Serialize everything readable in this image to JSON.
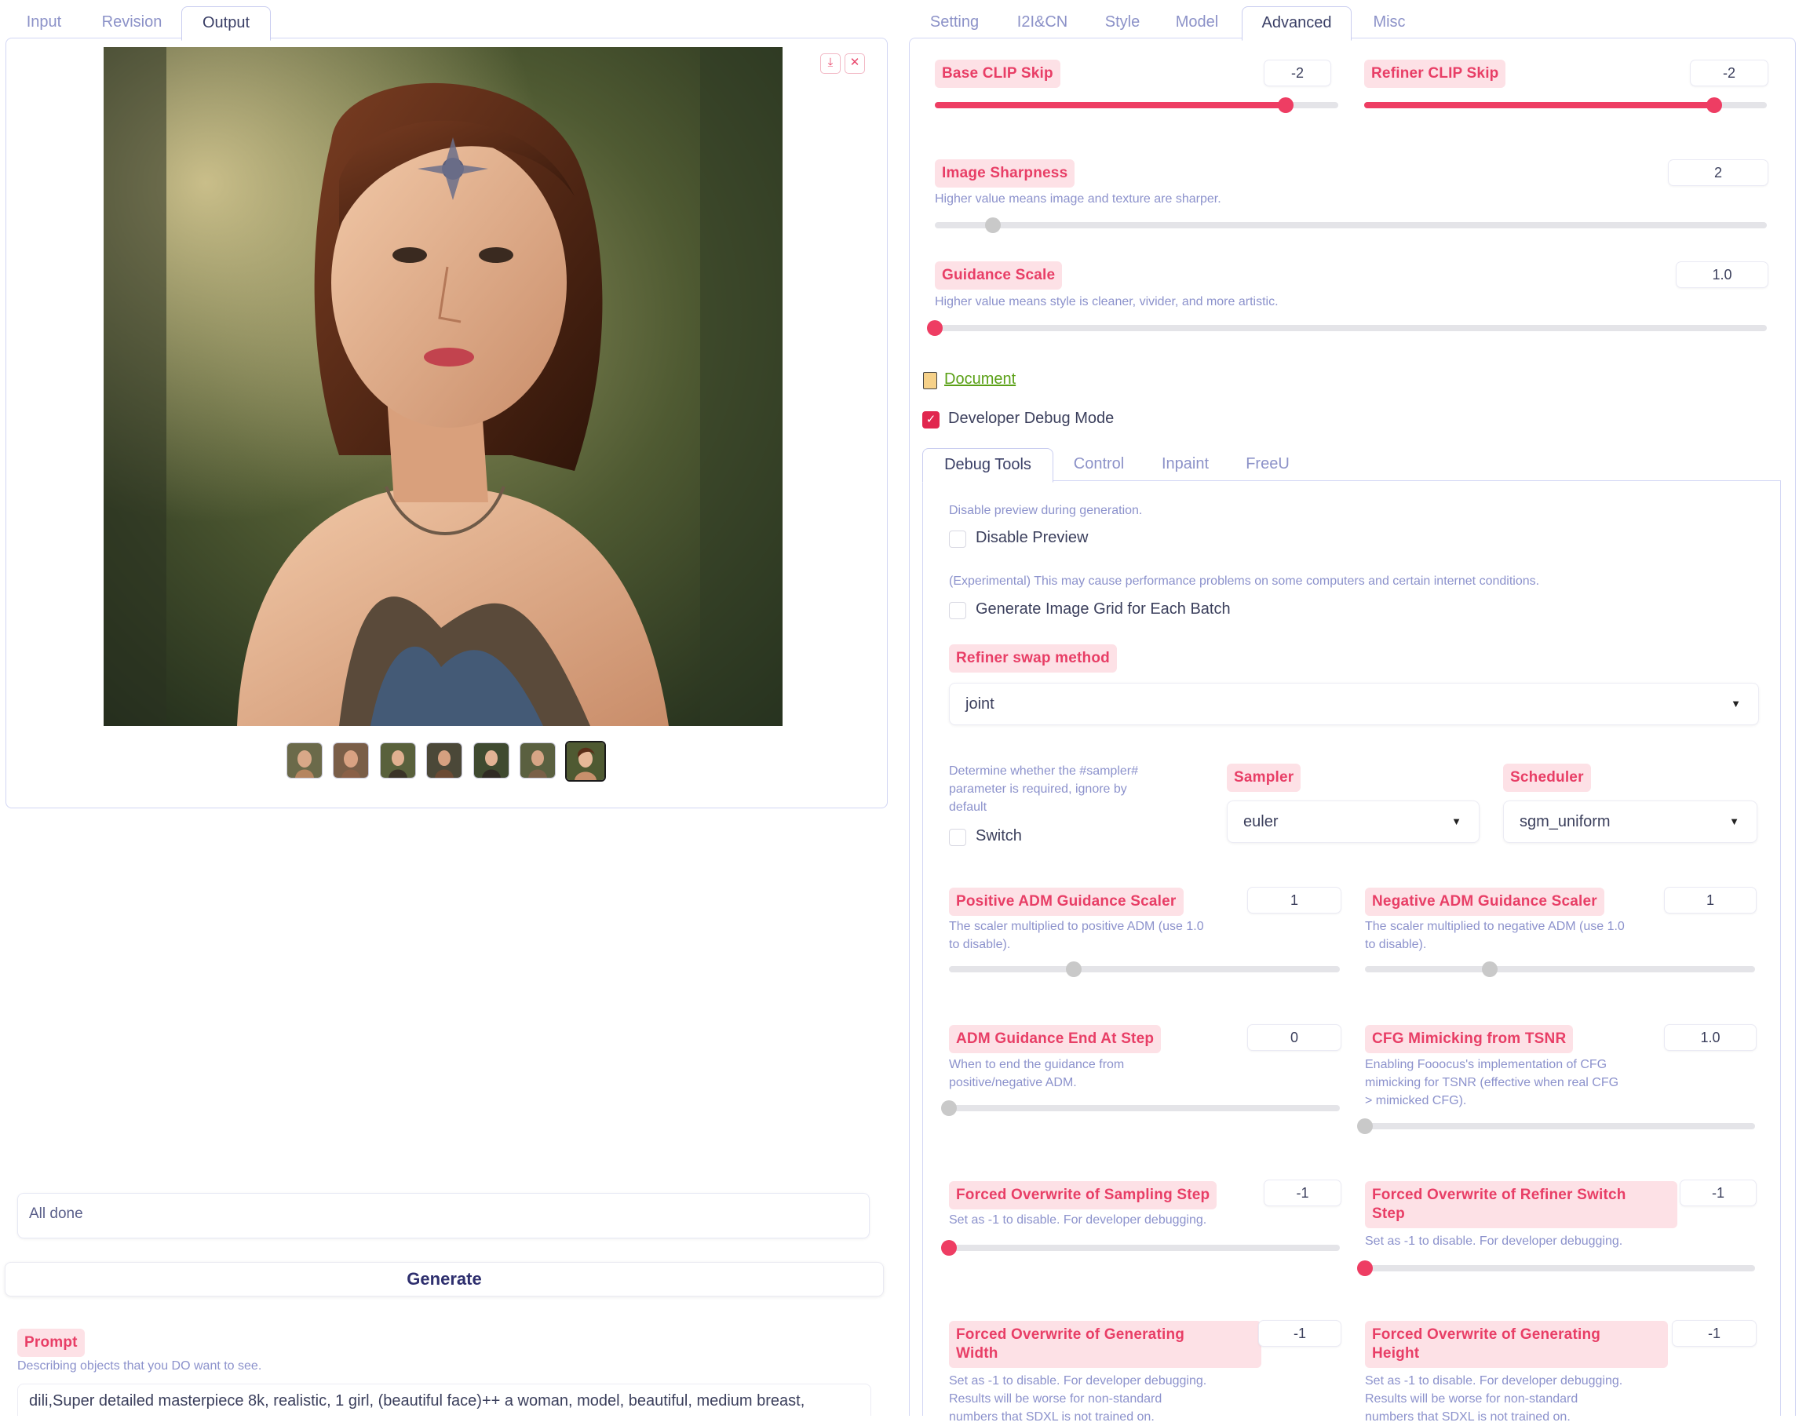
{
  "left_tabs": [
    "Input",
    "Revision",
    "Output"
  ],
  "right_tabs": [
    "Setting",
    "I2I&CN",
    "Style",
    "Model",
    "Advanced",
    "Misc"
  ],
  "image_controls": {
    "download_icon": "⤓",
    "close_icon": "✕"
  },
  "status_text": "All done",
  "generate_label": "Generate",
  "prompt": {
    "label": "Prompt",
    "info": "Describing objects that you DO want to see.",
    "value": "dili,Super detailed masterpiece 8k, realistic, 1 girl, (beautiful face)++ a woman, model, beautiful, medium breast,"
  },
  "advanced": {
    "base_clip_skip": {
      "label": "Base CLIP Skip",
      "value": "-2",
      "level": 0.87
    },
    "refiner_clip_skip": {
      "label": "Refiner CLIP Skip",
      "value": "-2",
      "level": 0.87
    },
    "image_sharpness": {
      "label": "Image Sharpness",
      "info": "Higher value means image and texture are sharper.",
      "value": "2",
      "level": 0.07
    },
    "guidance_scale": {
      "label": "Guidance Scale",
      "info": "Higher value means style is cleaner, vivider, and more artistic.",
      "value": "1.0",
      "level": 0.0
    },
    "document_link": "Document",
    "debug_mode_label": "Developer Debug Mode"
  },
  "debug_tabs": [
    "Debug Tools",
    "Control",
    "Inpaint",
    "FreeU"
  ],
  "debug": {
    "disable_preview_info": "Disable preview during generation.",
    "disable_preview_label": "Disable Preview",
    "grid_info": "(Experimental) This may cause performance problems on some computers and certain internet conditions.",
    "grid_label": "Generate Image Grid for Each Batch",
    "refiner_swap_label": "Refiner swap method",
    "refiner_swap_value": "joint",
    "sampler_switch_info_1": "Determine whether the #sampler#",
    "sampler_switch_info_2": "parameter is required, ignore by",
    "sampler_switch_info_3": "default",
    "switch_label": "Switch",
    "sampler_label": "Sampler",
    "sampler_value": "euler",
    "scheduler_label": "Scheduler",
    "scheduler_value": "sgm_uniform",
    "pos_adm": {
      "label": "Positive ADM Guidance Scaler",
      "value": "1",
      "info_1": "The scaler multiplied to positive ADM (use 1.0",
      "info_2": "to disable).",
      "level": 0.32
    },
    "neg_adm": {
      "label": "Negative ADM Guidance Scaler",
      "value": "1",
      "info_1": "The scaler multiplied to negative ADM (use 1.0",
      "info_2": "to disable).",
      "level": 0.32
    },
    "adm_end": {
      "label": "ADM Guidance End At Step",
      "value": "0",
      "info_1": "When to end the guidance from",
      "info_2": "positive/negative ADM.",
      "level": 0.0
    },
    "cfg_tsnr": {
      "label": "CFG Mimicking from TSNR",
      "value": "1.0",
      "info_1": "Enabling Fooocus's implementation of CFG",
      "info_2": "mimicking for TSNR (effective when real CFG",
      "info_3": "> mimicked CFG).",
      "level": 0.0
    },
    "overwrite_sampling": {
      "label": "Forced Overwrite of Sampling Step",
      "value": "-1",
      "info": "Set as -1 to disable. For developer debugging.",
      "level": 0.0
    },
    "overwrite_refiner": {
      "label_1": "Forced Overwrite of Refiner Switch",
      "label_2": "Step",
      "value": "-1",
      "info": "Set as -1 to disable. For developer debugging.",
      "level": 0.0
    },
    "overwrite_width": {
      "label_1": "Forced Overwrite of Generating",
      "label_2": "Width",
      "value": "-1",
      "info_1": "Set as -1 to disable. For developer debugging.",
      "info_2": "Results will be worse for non-standard",
      "info_3": "numbers that SDXL is not trained on."
    },
    "overwrite_height": {
      "label_1": "Forced Overwrite of Generating",
      "label_2": "Height",
      "value": "-1",
      "info_1": "Set as -1 to disable. For developer debugging.",
      "info_2": "Results will be worse for non-standard",
      "info_3": "numbers that SDXL is not trained on."
    }
  },
  "colors": {
    "accent": "#ee3d63",
    "label_bg": "#fde1e6",
    "info_text": "#8c92cc"
  }
}
